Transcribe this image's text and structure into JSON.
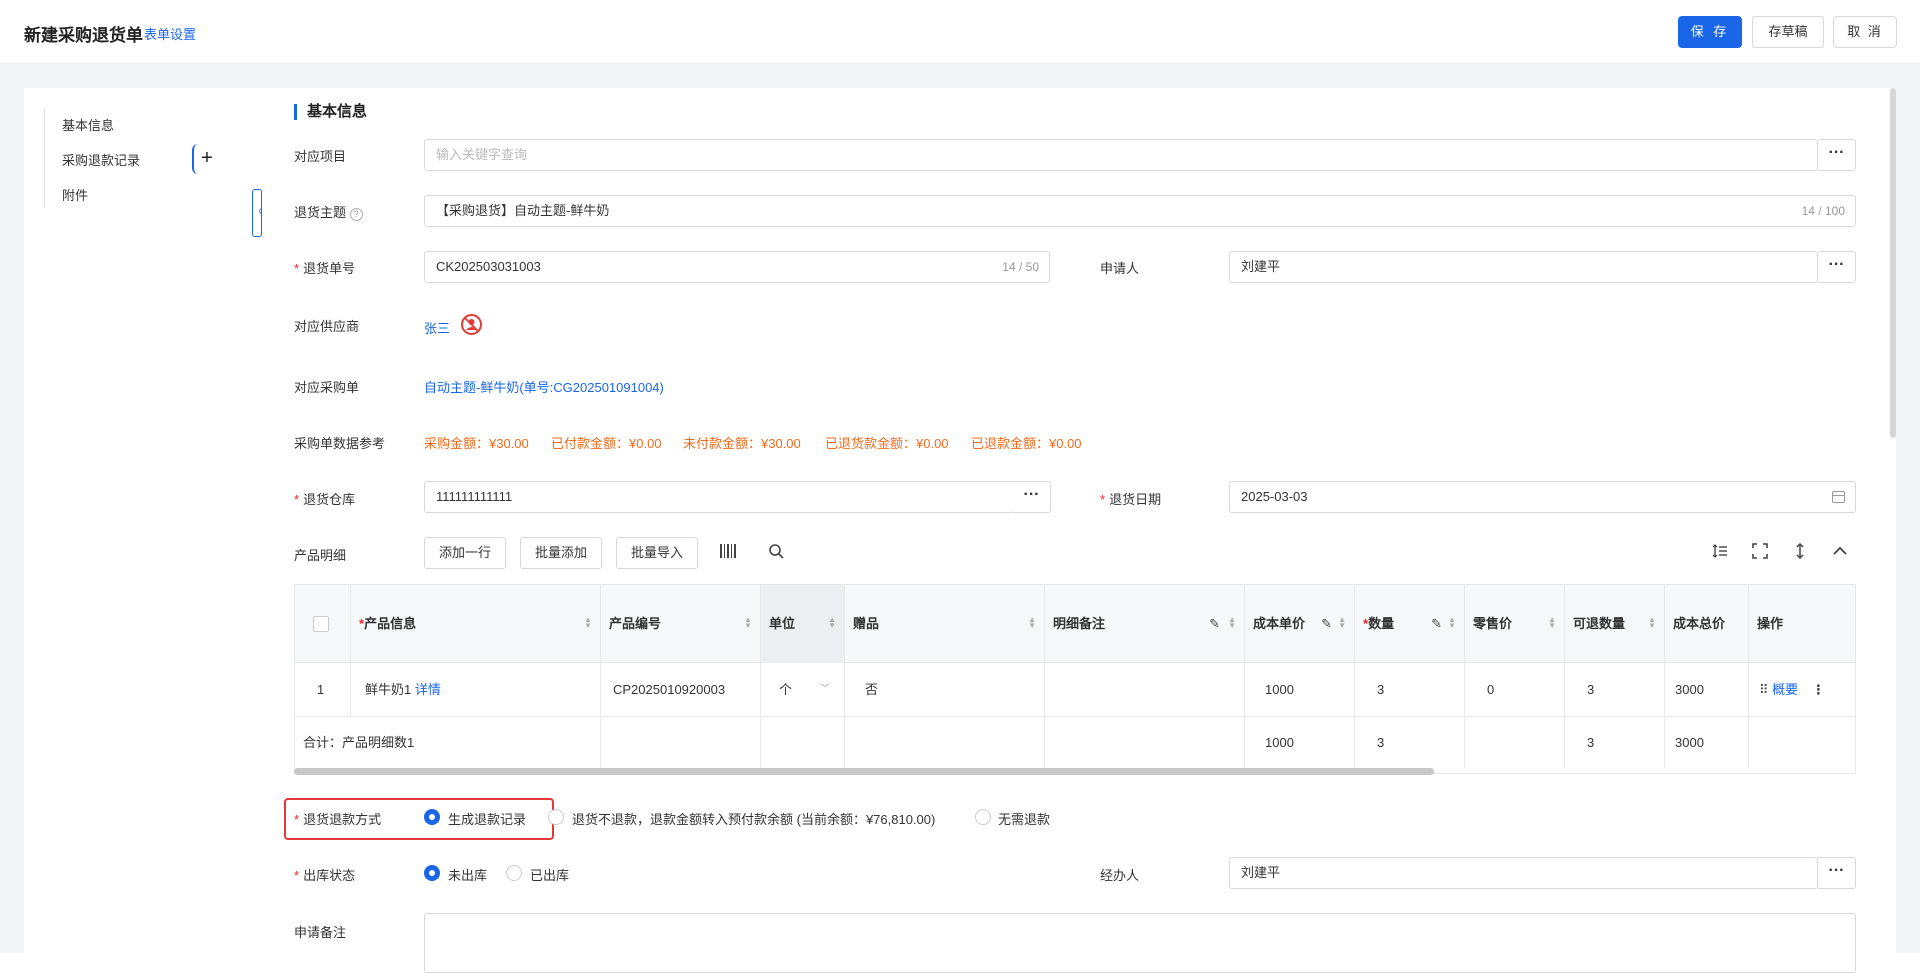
{
  "header": {
    "title": "新建采购退货单",
    "form_settings": "表单设置",
    "save": "保 存",
    "draft": "存草稿",
    "cancel": "取 消"
  },
  "sidebar": {
    "items": [
      {
        "label": "基本信息"
      },
      {
        "label": "采购退款记录"
      },
      {
        "label": "附件"
      }
    ],
    "add_symbol": "+",
    "collapse_symbol": "〈"
  },
  "section": {
    "title": "基本信息"
  },
  "fields": {
    "project": {
      "label": "对应项目",
      "placeholder": "输入关键字查询"
    },
    "subject": {
      "label": "退货主题",
      "value": "【采购退货】自动主题-鲜牛奶",
      "counter": "14 / 100"
    },
    "order_no": {
      "label": "退货单号",
      "value": "CK202503031003",
      "counter": "14 / 50"
    },
    "applicant": {
      "label": "申请人",
      "value": "刘建平"
    },
    "supplier": {
      "label": "对应供应商",
      "value": "张三"
    },
    "purchase_order": {
      "label": "对应采购单",
      "value": "自动主题-鲜牛奶(单号:CG202501091004)"
    },
    "reference": {
      "label": "采购单数据参考",
      "items": [
        "采购金额：¥30.00",
        "已付款金额：¥0.00",
        "未付款金额：¥30.00",
        "已退货款金额：¥0.00",
        "已退款金额：¥0.00"
      ]
    },
    "warehouse": {
      "label": "退货仓库",
      "value": "111111111111"
    },
    "return_date": {
      "label": "退货日期",
      "value": "2025-03-03"
    },
    "product_detail": {
      "label": "产品明细"
    },
    "refund_method": {
      "label": "退货退款方式",
      "options": [
        "生成退款记录",
        "退货不退款，退款金额转入预付款余额 (当前余额：¥76,810.00)",
        "无需退款"
      ],
      "selected": "生成退款记录"
    },
    "outbound_status": {
      "label": "出库状态",
      "options": [
        "未出库",
        "已出库"
      ],
      "selected": "未出库"
    },
    "handler": {
      "label": "经办人",
      "value": "刘建平"
    },
    "remark": {
      "label": "申请备注"
    }
  },
  "toolbar": {
    "add_row": "添加一行",
    "batch_add": "批量添加",
    "batch_import": "批量导入",
    "icons": [
      "barcode-icon",
      "search-icon",
      "row-height-icon",
      "fullscreen-icon",
      "expand-icon",
      "collapse-up-icon"
    ]
  },
  "table": {
    "columns": [
      "产品信息",
      "产品编号",
      "单位",
      "赠品",
      "明细备注",
      "成本单价",
      "数量",
      "零售价",
      "可退数量",
      "成本总价",
      "操作"
    ],
    "rows": [
      {
        "index": "1",
        "product": "鲜牛奶1",
        "detail_link": "详情",
        "code": "CP2025010920003",
        "unit": "个",
        "gift": "否",
        "remark": "",
        "unit_cost": "1000",
        "qty": "3",
        "retail": "0",
        "returnable": "3",
        "total_cost": "3000",
        "action": "概要"
      }
    ],
    "footer": {
      "label": "合计：产品明细数1",
      "unit_cost": "1000",
      "qty": "3",
      "returnable": "3",
      "total_cost": "3000"
    }
  },
  "colors": {
    "primary": "#1a66e8",
    "orange": "#f26b1d",
    "required": "#f5222d",
    "highlight": "#e53935"
  }
}
